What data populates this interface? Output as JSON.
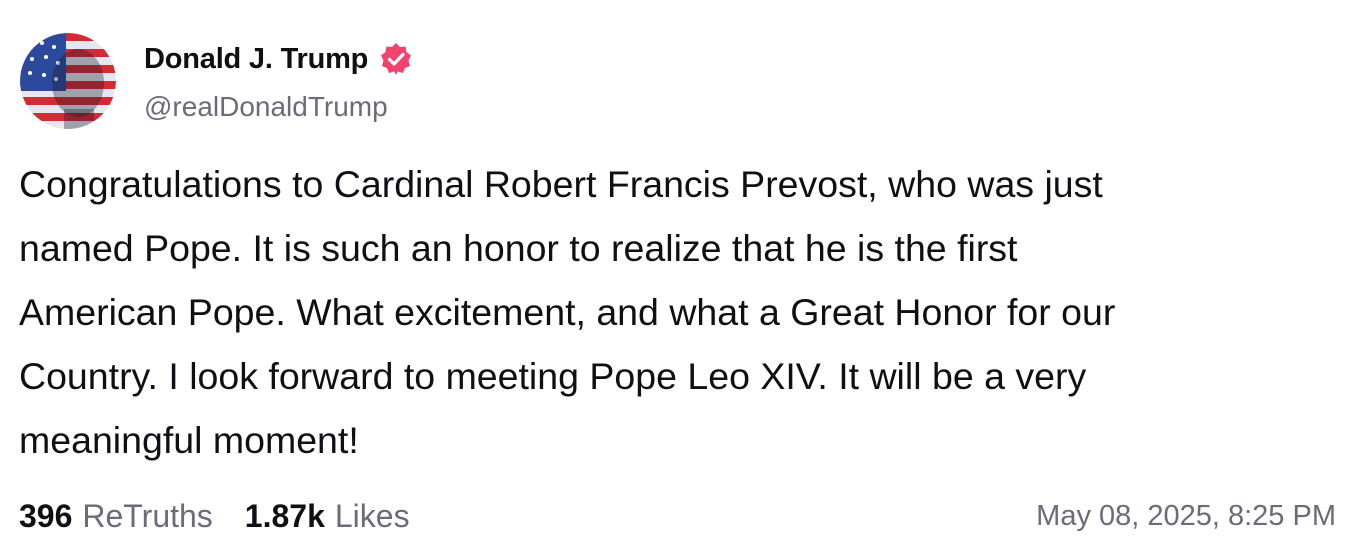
{
  "author": {
    "display_name": "Donald J. Trump",
    "handle": "@realDonaldTrump",
    "avatar_icon": "flag-portrait-avatar",
    "verified_icon": "verified-badge-icon",
    "verified_color": "#f0436e"
  },
  "post": {
    "lines": [
      "Congratulations to Cardinal Robert Francis Prevost, who was just",
      "named Pope. It is such an honor to realize that he is the first",
      "American Pope. What excitement, and what a Great Honor for our",
      "Country. I look forward to meeting Pope Leo XIV. It will be a very",
      "meaningful moment!"
    ]
  },
  "stats": {
    "retruths_count": "396",
    "retruths_label": "ReTruths",
    "likes_count": "1.87k",
    "likes_label": "Likes"
  },
  "timestamp": "May 08, 2025, 8:25 PM"
}
